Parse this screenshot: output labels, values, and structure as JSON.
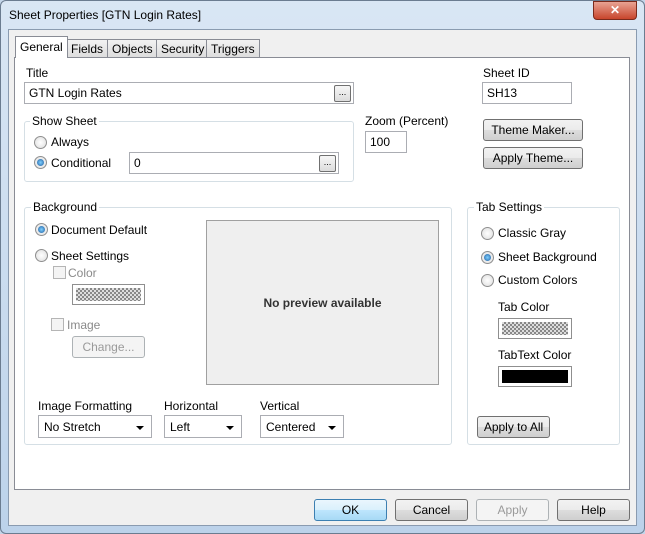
{
  "window": {
    "title": "Sheet Properties [GTN Login Rates]",
    "close": "✕"
  },
  "tabs": [
    "General",
    "Fields",
    "Objects",
    "Security",
    "Triggers"
  ],
  "general": {
    "title_label": "Title",
    "title_value": "GTN Login Rates",
    "ellipsis": "...",
    "sheet_id_label": "Sheet ID",
    "sheet_id_value": "SH13",
    "show_sheet": {
      "label": "Show Sheet",
      "always": "Always",
      "conditional": "Conditional",
      "condition_value": "0"
    },
    "zoom": {
      "label": "Zoom (Percent)",
      "value": "100"
    },
    "theme_maker": "Theme Maker...",
    "apply_theme": "Apply Theme...",
    "background": {
      "label": "Background",
      "document_default": "Document Default",
      "sheet_settings": "Sheet Settings",
      "color": "Color",
      "image": "Image",
      "change": "Change...",
      "preview": "No preview available",
      "image_formatting_label": "Image Formatting",
      "image_formatting": "No Stretch",
      "horizontal_label": "Horizontal",
      "horizontal": "Left",
      "vertical_label": "Vertical",
      "vertical": "Centered"
    },
    "tab_settings": {
      "label": "Tab Settings",
      "classic_gray": "Classic Gray",
      "sheet_background": "Sheet Background",
      "custom_colors": "Custom Colors",
      "tab_color": "Tab Color",
      "tab_text_color": "TabText Color",
      "apply_to_all": "Apply to All"
    }
  },
  "footer": {
    "ok": "OK",
    "cancel": "Cancel",
    "apply": "Apply",
    "help": "Help"
  }
}
